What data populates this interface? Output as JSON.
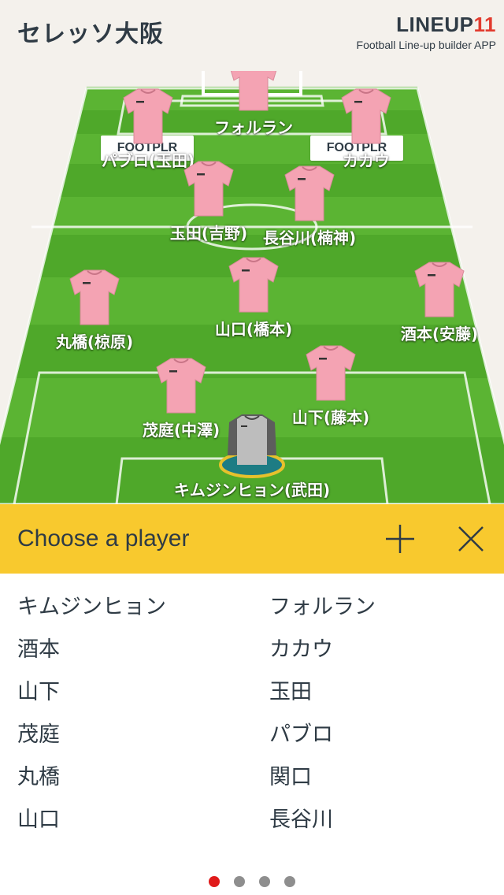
{
  "header": {
    "team_name": "セレッソ大阪",
    "brand_name": "LINEUP",
    "brand_number": "11",
    "brand_subtitle": "Football Line-up builder APP"
  },
  "pitch": {
    "ad_boards": [
      "FOOTPLR",
      "FOOTPLR"
    ],
    "players": [
      {
        "name": "フォルラン",
        "shirt": "pink"
      },
      {
        "name": "パブロ(玉田)",
        "shirt": "pink"
      },
      {
        "name": "カカウ",
        "shirt": "pink"
      },
      {
        "name": "玉田(吉野)",
        "shirt": "pink"
      },
      {
        "name": "長谷川(楠神)",
        "shirt": "pink"
      },
      {
        "name": "丸橋(椋原)",
        "shirt": "pink"
      },
      {
        "name": "山口(橋本)",
        "shirt": "pink"
      },
      {
        "name": "酒本(安藤)",
        "shirt": "pink"
      },
      {
        "name": "茂庭(中澤)",
        "shirt": "pink"
      },
      {
        "name": "山下(藤本)",
        "shirt": "pink"
      },
      {
        "name": "キムジンヒョン(武田)",
        "shirt": "gray"
      }
    ]
  },
  "chooser": {
    "title": "Choose a player",
    "add_icon": "plus-icon",
    "close_icon": "close-icon"
  },
  "player_list": {
    "left": [
      "キムジンヒョン",
      "酒本",
      "山下",
      "茂庭",
      "丸橋",
      "山口"
    ],
    "right": [
      "フォルラン",
      "カカウ",
      "玉田",
      "パブロ",
      "関口",
      "長谷川"
    ]
  },
  "pagination": {
    "total": 4,
    "current": 1
  },
  "colors": {
    "accent_yellow": "#f8c92e",
    "pitch_green": "#4fa82a",
    "shirt_pink": "#f4a3b3",
    "text_dark": "#2f3b45",
    "active_dot": "#e01b1b"
  }
}
